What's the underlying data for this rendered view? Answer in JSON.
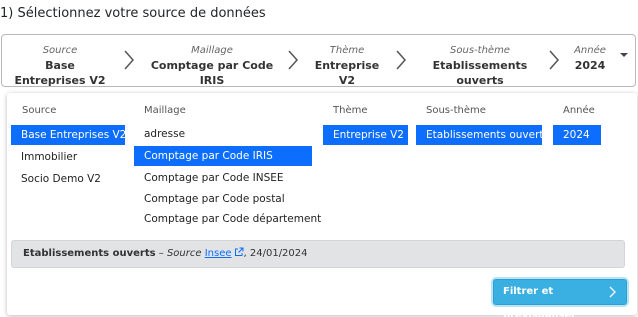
{
  "heading": "1) Sélectionnez votre source de données",
  "breadcrumb": [
    {
      "label": "Source",
      "value": "Base Entreprises V2"
    },
    {
      "label": "Maillage",
      "value": "Comptage par Code IRIS"
    },
    {
      "label": "Thème",
      "value": "Entreprise V2"
    },
    {
      "label": "Sous-thème",
      "value": "Etablissements ouverts"
    },
    {
      "label": "Année",
      "value": "2024"
    }
  ],
  "columns": {
    "source": {
      "header": "Source",
      "options": [
        "Base Entreprises V2",
        "Immobilier",
        "Socio Demo V2"
      ],
      "selected": "Base Entreprises V2"
    },
    "maillage": {
      "header": "Maillage",
      "options": [
        "adresse",
        "Comptage par Code IRIS",
        "Comptage par Code INSEE",
        "Comptage par Code postal",
        "Comptage par Code département"
      ],
      "selected": "Comptage par Code IRIS"
    },
    "theme": {
      "header": "Thème",
      "options": [
        "Entreprise V2"
      ],
      "selected": "Entreprise V2"
    },
    "sous_theme": {
      "header": "Sous-thème",
      "options": [
        "Etablissements ouverts"
      ],
      "selected": "Etablissements ouverts"
    },
    "annee": {
      "header": "Année",
      "options": [
        "2024"
      ],
      "selected": "2024"
    }
  },
  "info": {
    "title": "Etablissements ouverts",
    "dash": "–",
    "source_prefix": "Source",
    "source_link": "Insee",
    "date": ", 24/01/2024"
  },
  "button_label": "Filtrer et prévisualiser",
  "icons": {
    "chevron": "chevron-right-icon",
    "dropdown": "caret-down-icon",
    "external": "external-link-icon"
  },
  "colors": {
    "selected_bg": "#0d6efd",
    "button_bg": "#3ab0e2",
    "info_bg": "#e2e3e5"
  }
}
